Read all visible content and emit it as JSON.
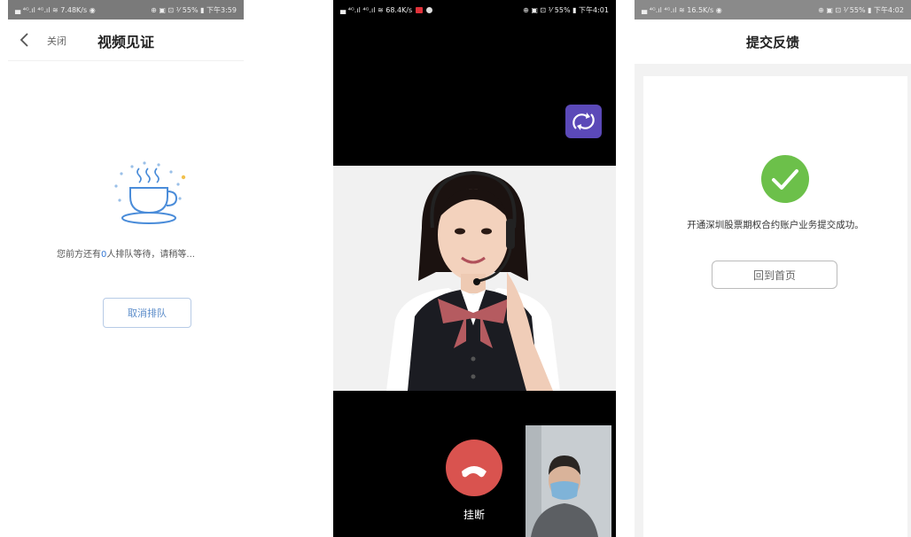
{
  "screen1": {
    "status": {
      "left": "▄ ⁴ᴳ.ıl ⁴ᴳ.ıl ≋ 7.48K/s ◉",
      "right": "⊕ ▣ ⊡ ⅟ 55% ▮ 下午3:59"
    },
    "nav": {
      "close_label": "关闭",
      "title": "视频见证"
    },
    "queue": {
      "prefix": "您前方还有",
      "count": "0",
      "suffix": "人排队等待，请稍等..."
    },
    "cancel_button": "取消排队"
  },
  "screen2": {
    "status": {
      "left": "▄ ⁴ᴳ.ıl ⁴ᴳ.ıl ≋ 68.4K/s",
      "right": "⊕ ▣ ⊡ ⅟ 55% ▮ 下午4:01"
    },
    "hangup_label": "挂断",
    "colors": {
      "camera_switch": "#5b49b8",
      "hangup": "#d9534f"
    }
  },
  "screen3": {
    "status": {
      "left": "▄ ⁴ᴳ.ıl ⁴ᴳ.ıl ≋ 16.5K/s ◉",
      "right": "⊕ ▣ ⊡ ⅟ 55% ▮ 下午4:02"
    },
    "nav": {
      "title": "提交反馈"
    },
    "success_text": "开通深圳股票期权合约账户业务提交成功。",
    "home_button": "回到首页",
    "colors": {
      "success": "#6cc04a"
    }
  }
}
